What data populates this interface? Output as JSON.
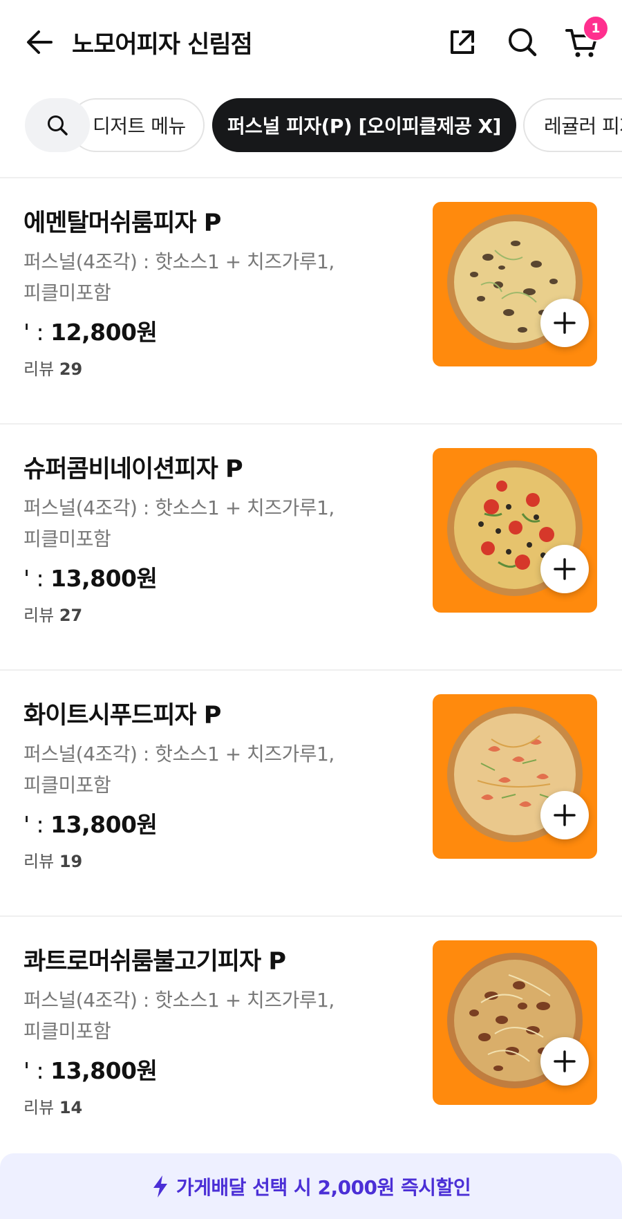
{
  "header": {
    "title": "노모어피자 신림점",
    "cart_count": "1",
    "icons": {
      "back": "arrow-left-icon",
      "share": "share-icon",
      "search": "search-icon",
      "cart": "cart-icon"
    }
  },
  "category_tabs": {
    "search_icon": "search-icon",
    "items": [
      {
        "label": "디저트 메뉴",
        "selected": false
      },
      {
        "label": "퍼스널 피자(P) [오이피클제공 X]",
        "selected": true
      },
      {
        "label": "레귤러 피자",
        "selected": false
      }
    ]
  },
  "menu": {
    "items": [
      {
        "name": "에멘탈머쉬룸피자 P",
        "desc_line1": "퍼스널(4조각) : 핫소스1 + 치즈가루1,",
        "desc_line2": "피클미포함",
        "price_prefix": "' : ",
        "price": "12,800원",
        "review_label": "리뷰",
        "review_count": "29",
        "image": "mushroom-pizza"
      },
      {
        "name": "슈퍼콤비네이션피자 P",
        "desc_line1": "퍼스널(4조각) : 핫소스1 + 치즈가루1,",
        "desc_line2": "피클미포함",
        "price_prefix": "' : ",
        "price": "13,800원",
        "review_label": "리뷰",
        "review_count": "27",
        "image": "combination-pizza"
      },
      {
        "name": "화이트시푸드피자 P",
        "desc_line1": "퍼스널(4조각) : 핫소스1 + 치즈가루1,",
        "desc_line2": "피클미포함",
        "price_prefix": "' : ",
        "price": "13,800원",
        "review_label": "리뷰",
        "review_count": "19",
        "image": "seafood-pizza"
      },
      {
        "name": "콰트로머쉬룸불고기피자 P",
        "desc_line1": "퍼스널(4조각) : 핫소스1 + 치즈가루1,",
        "desc_line2": "피클미포함",
        "price_prefix": "' : ",
        "price": "13,800원",
        "review_label": "리뷰",
        "review_count": "14",
        "image": "bulgogi-pizza"
      }
    ]
  },
  "promo": {
    "icon": "lightning-icon",
    "text": "가게배달 선택 시 2,000원 즉시할인"
  },
  "colors": {
    "accent_dark": "#17181a",
    "image_bg": "#ff8a0d",
    "badge": "#ff2f8e",
    "promo_text": "#4b2fd6",
    "promo_bg": "#eef0ff"
  }
}
